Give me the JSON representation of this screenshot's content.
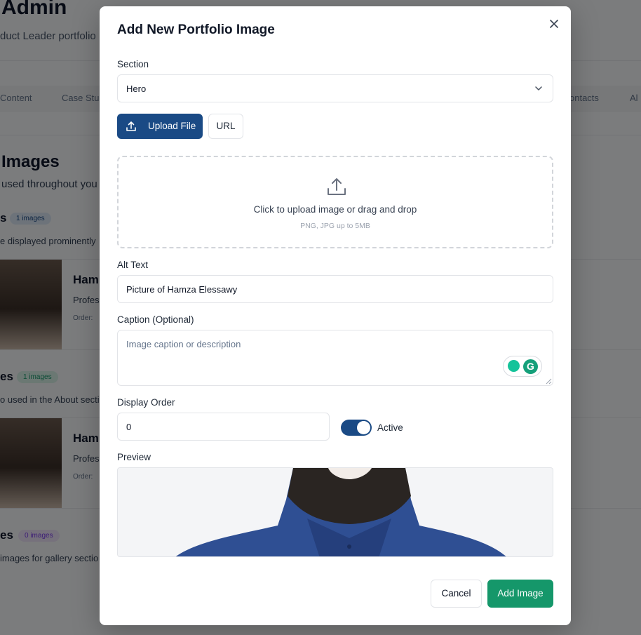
{
  "background": {
    "title": "Admin",
    "subtitle": "duct Leader portfolio",
    "tabs": [
      "Content",
      "Case Stu",
      "ontacts",
      "Al"
    ],
    "section_title": "Images",
    "section_desc": "used throughout you",
    "groups": [
      {
        "name": "s",
        "count": "1 images",
        "desc": "e displayed prominently",
        "item_name": "Ham",
        "item_sub": "Profes",
        "item_order": "Order:"
      },
      {
        "name": "es",
        "count": "1 images",
        "desc": "o used in the About secti",
        "item_name": "Ham",
        "item_sub": "Profes",
        "item_order": "Order:"
      },
      {
        "name": "es",
        "count": "0 images",
        "desc": "images for gallery sectio"
      }
    ]
  },
  "modal": {
    "title": "Add New Portfolio Image",
    "section_label": "Section",
    "section_value": "Hero",
    "upload_file_label": "Upload File",
    "url_label": "URL",
    "dropzone_text": "Click to upload image or drag and drop",
    "dropzone_hint": "PNG, JPG up to 5MB",
    "alt_label": "Alt Text",
    "alt_value": "Picture of Hamza Elessawy",
    "caption_label": "Caption (Optional)",
    "caption_placeholder": "Image caption or description",
    "order_label": "Display Order",
    "order_value": "0",
    "active_label": "Active",
    "active_on": true,
    "preview_label": "Preview",
    "cancel_label": "Cancel",
    "add_label": "Add Image"
  },
  "colors": {
    "primary": "#1a4a85",
    "success": "#15976a",
    "overlay": "rgba(0,0,0,0.5)"
  }
}
